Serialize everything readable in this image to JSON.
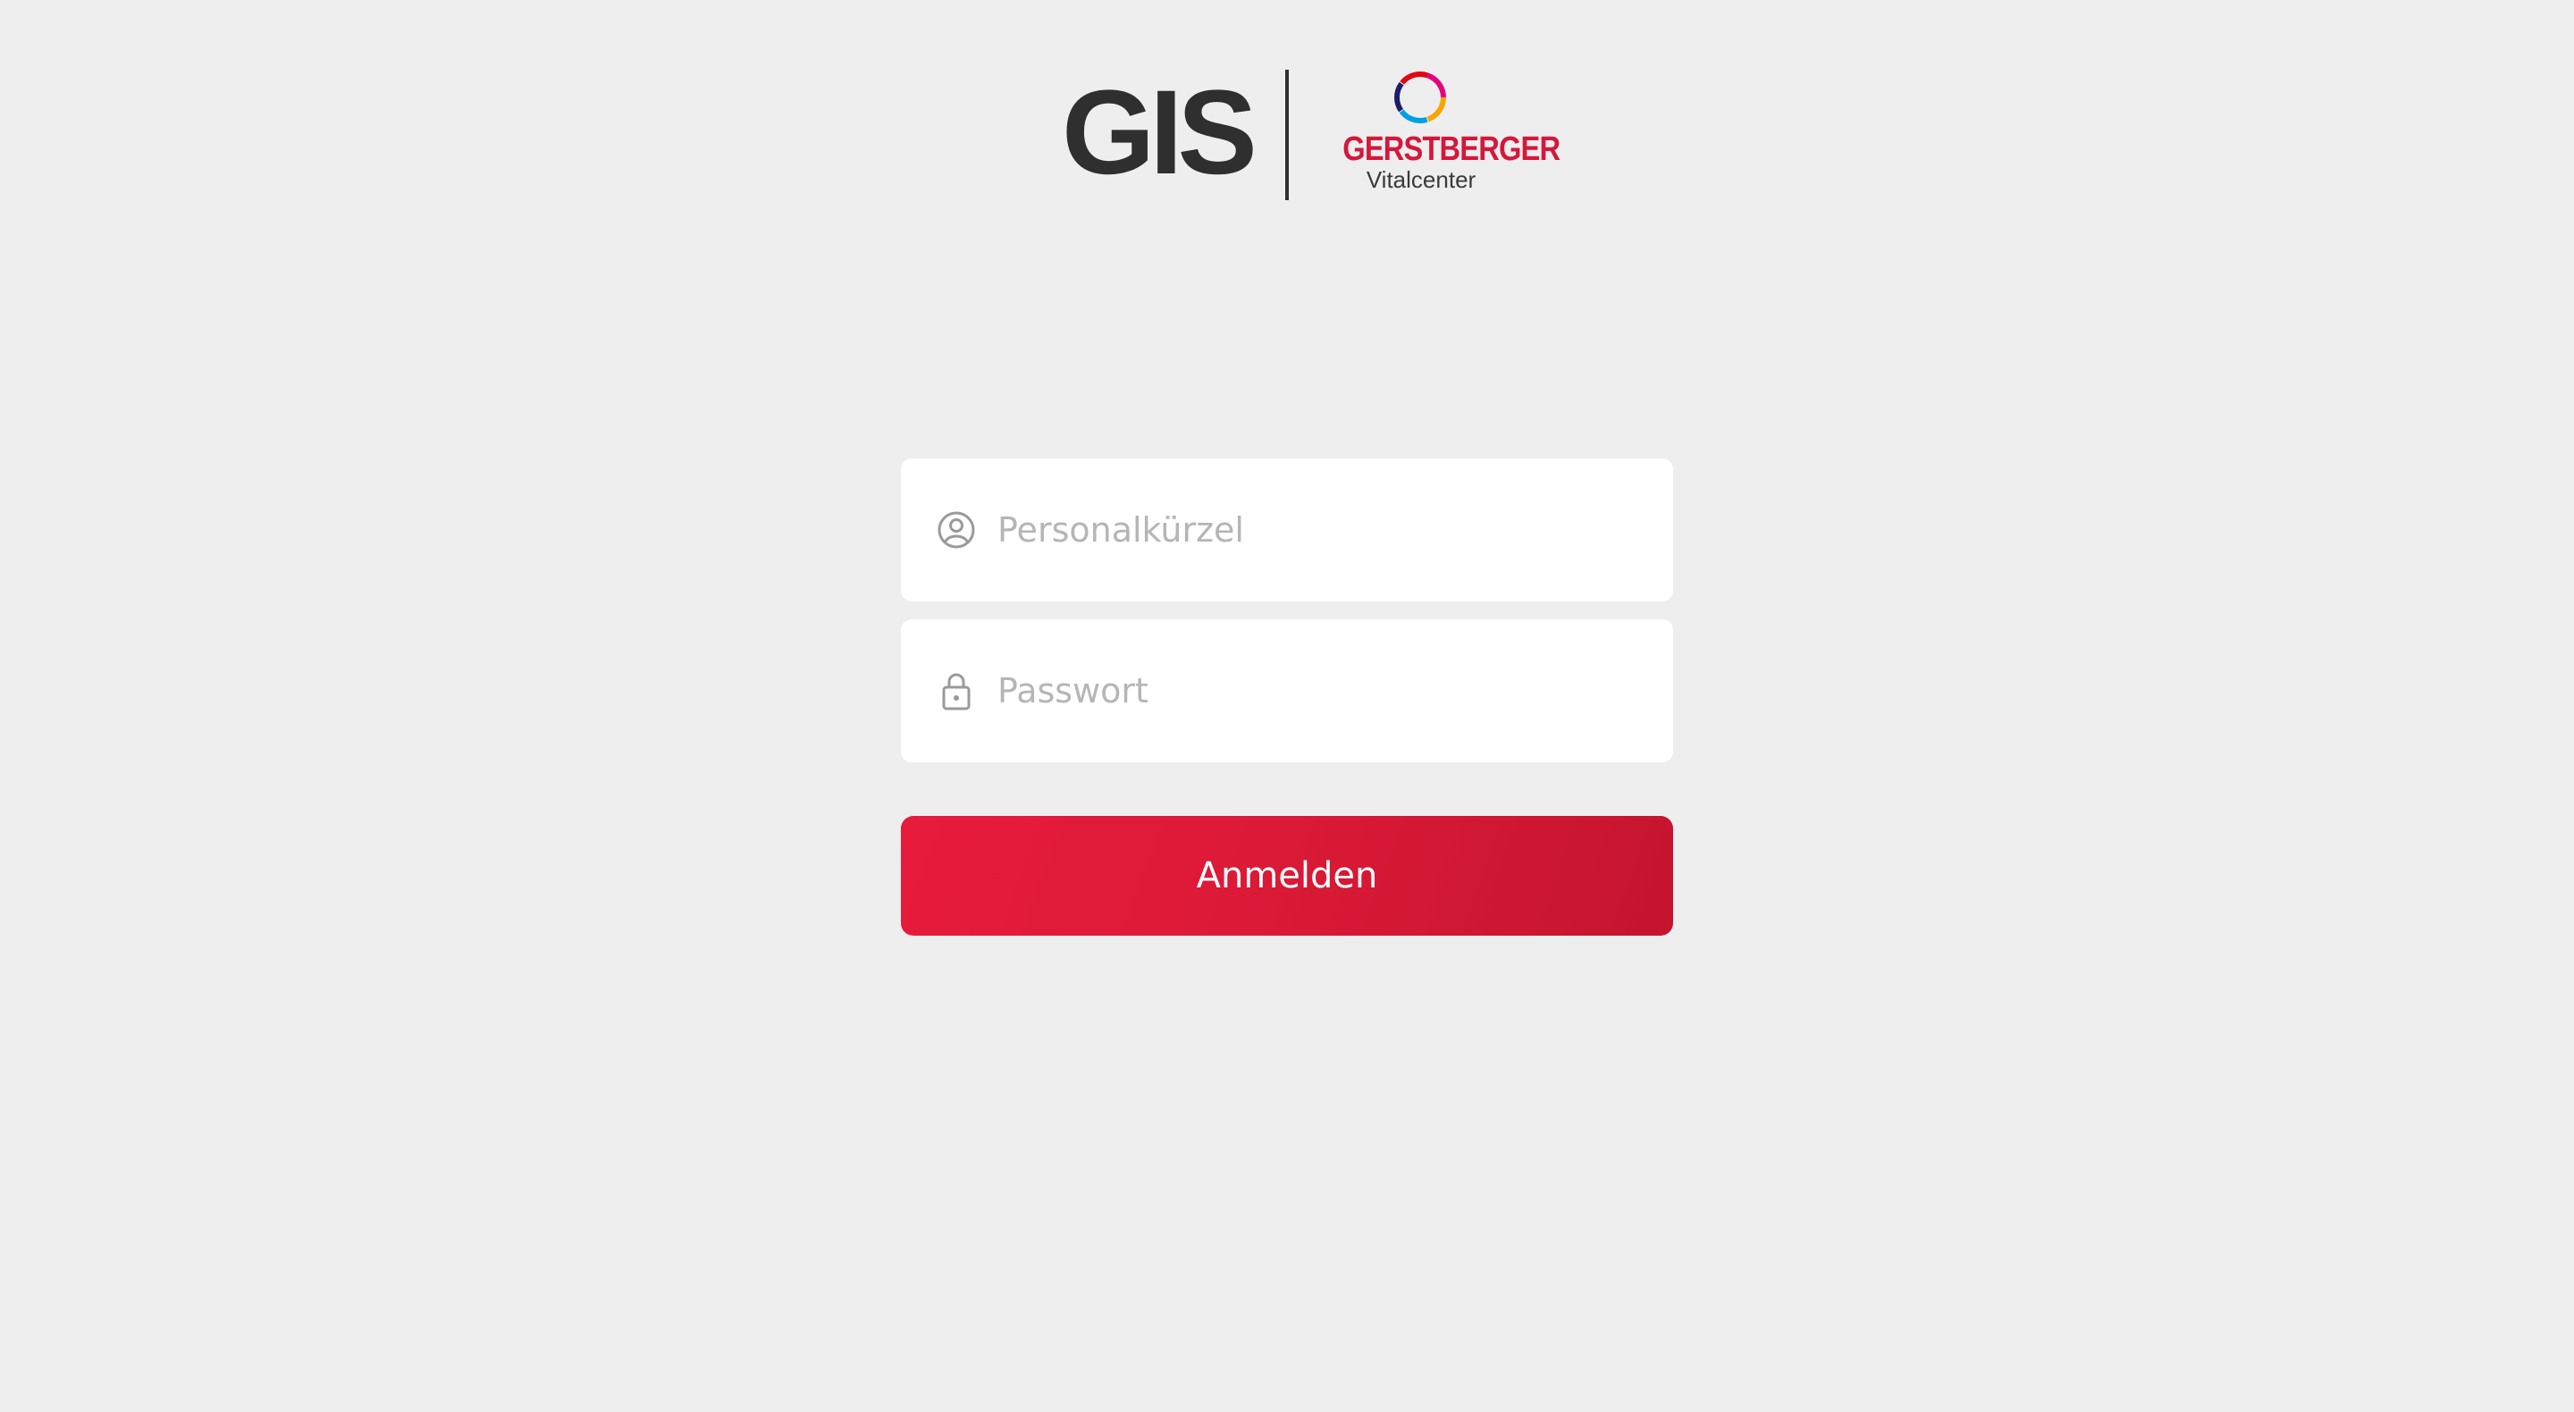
{
  "logo": {
    "gis_text": "GIS",
    "brand_name": "GERSTBERGER",
    "brand_sub": "Vitalcenter",
    "ring_colors": [
      "#e30613",
      "#f7a600",
      "#009fe3",
      "#1d1d6b",
      "#d4183d"
    ]
  },
  "form": {
    "username_placeholder": "Personalkürzel",
    "password_placeholder": "Passwort",
    "username_icon": "user-circle-icon",
    "password_icon": "lock-icon"
  },
  "login_button": {
    "label": "Anmelden"
  },
  "colors": {
    "background": "#eeeeee",
    "accent": "#dc1a37",
    "placeholder": "#b5b5b5"
  }
}
